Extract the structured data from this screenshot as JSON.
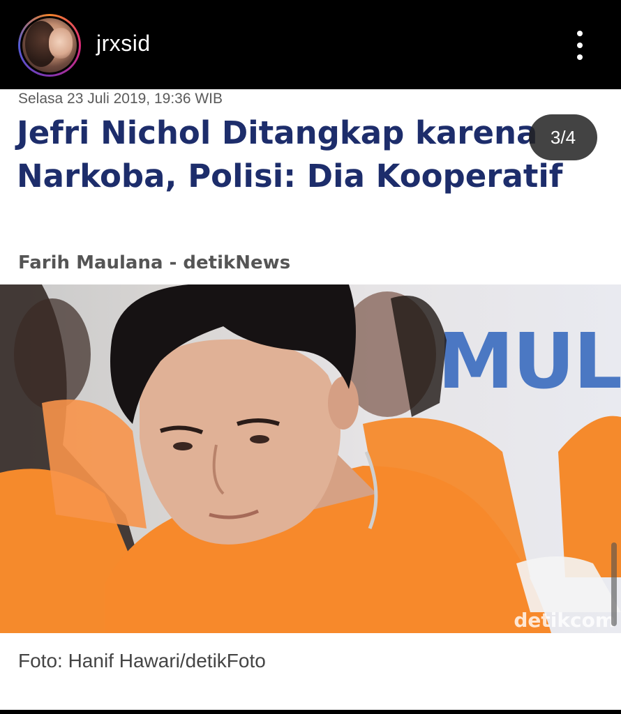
{
  "header": {
    "username": "jrxsid",
    "avatar_icon": "profile-avatar",
    "menu_icon": "more-vertical-icon"
  },
  "post": {
    "carousel_counter": "3/4",
    "article": {
      "date": "Selasa 23 Juli 2019, 19:36 WIB",
      "headline": "Jefri Nichol Ditangkap karena Narkoba, Polisi: Dia Kooperatif",
      "byline": "Farih Maulana - detikNews",
      "photo_background_text": "MUL",
      "photo_watermark": "detikcom",
      "caption": "Foto: Hanif Hawari/detikFoto"
    }
  },
  "colors": {
    "headline": "#1d2d6b",
    "shirt_orange": "#f58a2c",
    "background_header": "#000000"
  }
}
